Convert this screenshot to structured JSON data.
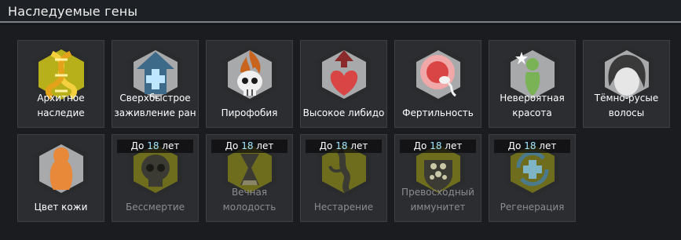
{
  "window": {
    "title": "Наследуемые гены"
  },
  "genes": [
    {
      "name_line1": "Архитное",
      "name_line2": "наследие",
      "icon": "dna-helix-icon",
      "locked": false
    },
    {
      "name_line1": "Сверхбыстрое",
      "name_line2": "заживление ран",
      "icon": "medical-cross-arrow-icon",
      "locked": false
    },
    {
      "name_line1": "Пирофобия",
      "name_line2": "",
      "icon": "flaming-skull-icon",
      "locked": false
    },
    {
      "name_line1": "Высокое либидо",
      "name_line2": "",
      "icon": "heart-arrow-icon",
      "locked": false
    },
    {
      "name_line1": "Фертильность",
      "name_line2": "",
      "icon": "sperm-egg-icon",
      "locked": false
    },
    {
      "name_line1": "Невероятная",
      "name_line2": "красота",
      "icon": "beauty-figure-icon",
      "locked": false
    },
    {
      "name_line1": "Тёмно-русые",
      "name_line2": "волосы",
      "icon": "hair-icon",
      "locked": false
    },
    {
      "name_line1": "Цвет кожи",
      "name_line2": "",
      "icon": "skin-color-icon",
      "locked": false
    },
    {
      "name_line1": "Бессмертие",
      "name_line2": "",
      "icon": "skull-icon",
      "locked": true,
      "age_prefix": "До",
      "age_value": "18",
      "age_suffix": "лет"
    },
    {
      "name_line1": "Вечная",
      "name_line2": "молодость",
      "icon": "hourglass-icon",
      "locked": true,
      "age_prefix": "До",
      "age_value": "18",
      "age_suffix": "лет"
    },
    {
      "name_line1": "Нестарение",
      "name_line2": "",
      "icon": "root-icon",
      "locked": true,
      "age_prefix": "До",
      "age_value": "18",
      "age_suffix": "лет"
    },
    {
      "name_line1": "Превосходный",
      "name_line2": "иммунитет",
      "icon": "cells-icon",
      "locked": true,
      "age_prefix": "До",
      "age_value": "18",
      "age_suffix": "лет"
    },
    {
      "name_line1": "Регенерация",
      "name_line2": "",
      "icon": "regeneration-cross-icon",
      "locked": true,
      "age_prefix": "До",
      "age_value": "18",
      "age_suffix": "лет"
    }
  ],
  "colors": {
    "hex_normal_outer": "#2a2b2d",
    "hex_normal_inner": "#a7a9ab",
    "hex_xenogene": "#7b7b22",
    "hex_archite": "#b8b01a",
    "age_number": "#9fe4ff"
  }
}
